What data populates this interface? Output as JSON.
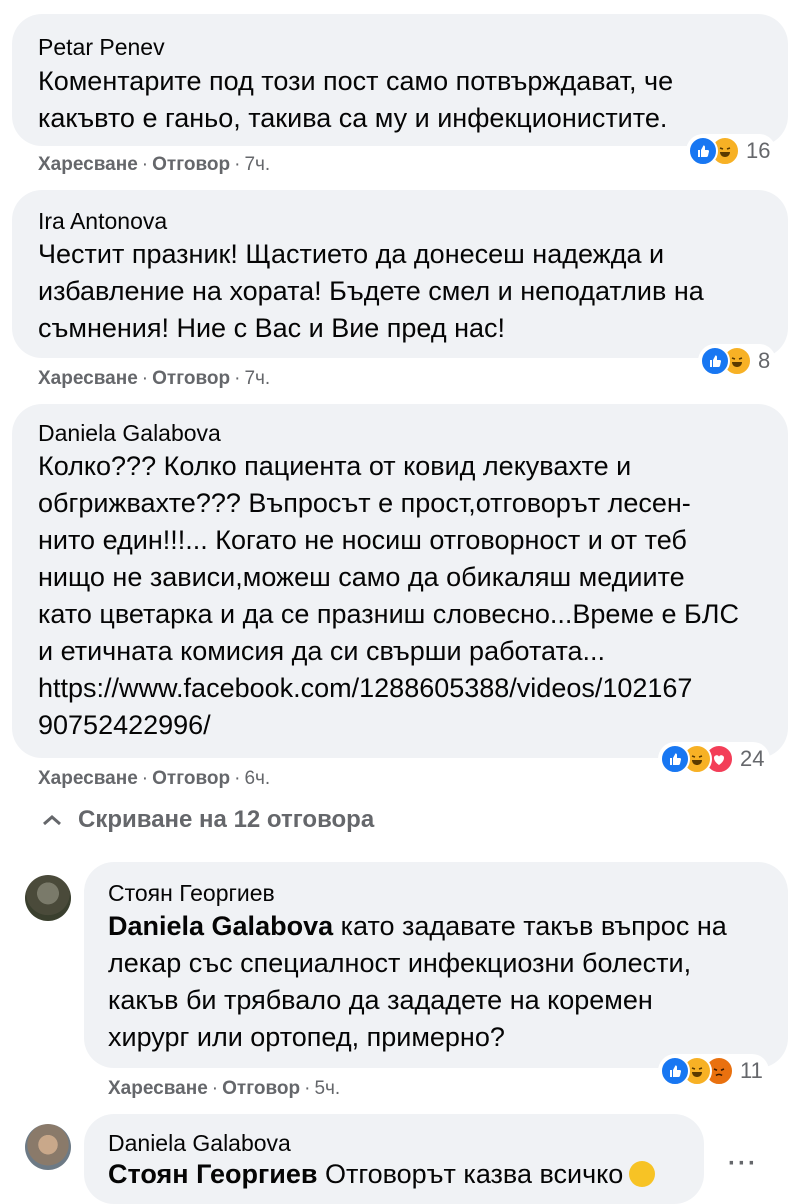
{
  "comments": [
    {
      "author": "Petar Penev",
      "text": "Коментарите под този пост само потвърждават, че\nкакъвто е ганьо, такива са му и инфекционистите.",
      "actions": {
        "like": "Харесване",
        "reply": "Отговор",
        "time": "7ч."
      },
      "reactions": {
        "count": "16"
      }
    },
    {
      "author": "Ira Antonova",
      "text": "Честит празник! Щастието да донесеш надежда и\nизбавление на хората! Бъдете смел и неподатлив на\nсъмнения! Ние с Вас и Вие пред нас!",
      "actions": {
        "like": "Харесване",
        "reply": "Отговор",
        "time": "7ч."
      },
      "reactions": {
        "count": "8"
      }
    },
    {
      "author": "Daniela Galabova",
      "text": "Колко??? Колко пациента от ковид лекувахте и\nобгрижвахте??? Въпросът е прост,отговорът лесен-\nнито един!!!... Когато не носиш отговорност и от теб\nнищо не зависи,можеш само да обикаляш медиите\nкато цветарка и да се празниш словесно...Време е БЛС\nи етичната комисия да си свърши работата...",
      "link": "https://www.facebook.com/1288605388/videos/102167\n90752422996/",
      "actions": {
        "like": "Харесване",
        "reply": "Отговор",
        "time": "6ч."
      },
      "reactions": {
        "count": "24"
      }
    }
  ],
  "hide_replies": "Скриване на 12 отговора",
  "replies": [
    {
      "author": "Стоян Георгиев",
      "mention": "Daniela Galabova",
      "text": " като задавате такъв въпрос на\nлекар със специалност инфекциозни болести,\nкакъв би трябвало да зададете на коремен\nхирург или ортопед, примерно?",
      "actions": {
        "like": "Харесване",
        "reply": "Отговор",
        "time": "5ч."
      },
      "reactions": {
        "count": "11"
      }
    },
    {
      "author": "Daniela Galabova",
      "mention": "Стоян Георгиев",
      "text": " Отговорът казва всичко",
      "more": "···"
    }
  ],
  "colors": {
    "bubble": "#f0f2f5",
    "meta": "#65676b",
    "like": "#1877f2",
    "haha": "#f7b125",
    "love": "#f33e58",
    "angry": "#e9710f"
  }
}
